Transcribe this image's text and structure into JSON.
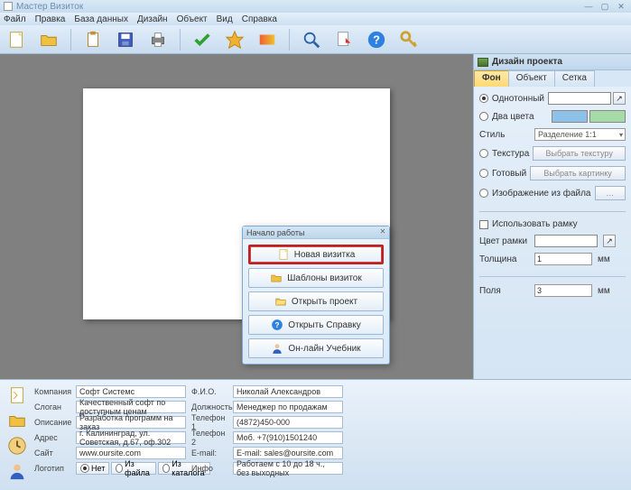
{
  "window": {
    "title": "Мастер Визиток"
  },
  "menu": [
    "Файл",
    "Правка",
    "База данных",
    "Дизайн",
    "Объект",
    "Вид",
    "Справка"
  ],
  "dialog": {
    "title": "Начало работы",
    "buttons": {
      "new": "Новая визитка",
      "templates": "Шаблоны визиток",
      "open": "Открыть проект",
      "help": "Открыть Справку",
      "tutorial": "Он-лайн Учебник"
    }
  },
  "side": {
    "title": "Дизайн проекта",
    "tabs": {
      "bg": "Фон",
      "obj": "Объект",
      "grid": "Сетка"
    },
    "solid": "Однотонный",
    "twocolor": "Два цвета",
    "style": "Стиль",
    "styleValue": "Разделение 1:1",
    "texture": "Текстура",
    "chooseTexture": "Выбрать текстуру",
    "ready": "Готовый",
    "choosePicture": "Выбрать картинку",
    "fromFile": "Изображение из файла",
    "useFrame": "Использовать рамку",
    "frameColor": "Цвет рамки",
    "thickness": "Толщина",
    "thicknessValue": "1",
    "margins": "Поля",
    "marginsValue": "3",
    "mm": "мм",
    "colors": {
      "solid": "#ffffff",
      "c1": "#8ec1e8",
      "c2": "#a6daa6",
      "frame": "#ffffff"
    }
  },
  "form": {
    "left": {
      "company": {
        "label": "Компания",
        "value": "Софт Системс"
      },
      "slogan": {
        "label": "Слоган",
        "value": "Качественный софт по доступным ценам"
      },
      "desc": {
        "label": "Описание",
        "value": "Разработка программ на заказ"
      },
      "address": {
        "label": "Адрес",
        "value": "г. Калининград, ул. Советская, д.67, оф.302"
      },
      "site": {
        "label": "Сайт",
        "value": "www.oursite.com"
      },
      "logo": {
        "label": "Логотип",
        "no": "Нет",
        "file": "Из файла",
        "catalog": "Из каталога"
      }
    },
    "right": {
      "fio": {
        "label": "Ф.И.О.",
        "value": "Николай Александров"
      },
      "position": {
        "label": "Должность",
        "value": "Менеджер по продажам"
      },
      "phone1": {
        "label": "Телефон 1",
        "value": "(4872)450-000"
      },
      "phone2": {
        "label": "Телефон 2",
        "value": "Моб. +7(910)1501240"
      },
      "email": {
        "label": "E-mail:",
        "value": "E-mail: sales@oursite.com"
      },
      "info": {
        "label": "Инфо",
        "value": "Работаем с 10 до 18 ч., без выходных"
      }
    }
  }
}
